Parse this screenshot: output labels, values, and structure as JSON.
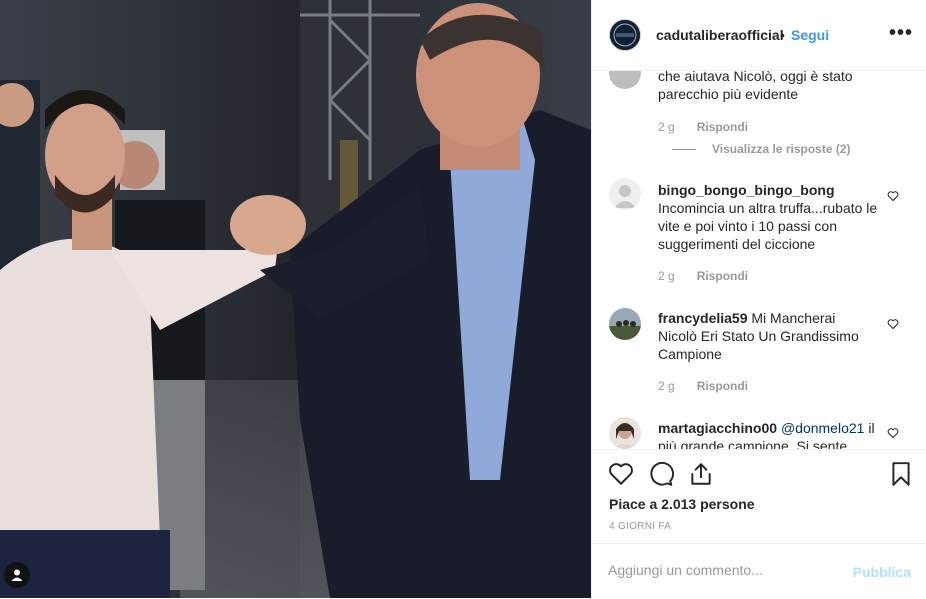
{
  "header": {
    "username": "cadutaliberaofficial",
    "separator": "•",
    "follow_label": "Segui",
    "more_label": "•••"
  },
  "comments": [
    {
      "username": "",
      "text": "che aiutava Nicolò, oggi è stato parecchio più evidente",
      "time": "2 g",
      "reply_label": "Rispondi",
      "view_replies": "Visualizza le risposte (2)"
    },
    {
      "username": "bingo_bongo_bingo_bong",
      "text": "Incomincia un altra truffa...rubato le vite e poi vinto i 10 passi con suggerimenti del ciccione",
      "time": "2 g",
      "reply_label": "Rispondi"
    },
    {
      "username": "francydelia59",
      "text": "Mi Mancherai Nicolò Eri Stato Un Grandissimo Campione",
      "time": "2 g",
      "reply_label": "Rispondi"
    },
    {
      "username": "martagiacchino00",
      "mention": "@donmelo21",
      "text": "il più grande campione. Si sente"
    }
  ],
  "actions": {
    "likes": "Piace a 2.013 persone",
    "time": "4 GIORNI FA"
  },
  "add_comment": {
    "placeholder": "Aggiungi un commento...",
    "publish_label": "Pubblica"
  },
  "icons": [
    "user-tag-icon",
    "heart-icon",
    "comment-icon",
    "share-icon",
    "bookmark-icon",
    "more-icon"
  ],
  "colors": {
    "link": "#3897f0",
    "publish_disabled": "#b2dffc",
    "muted": "#999999",
    "text": "#262626"
  }
}
